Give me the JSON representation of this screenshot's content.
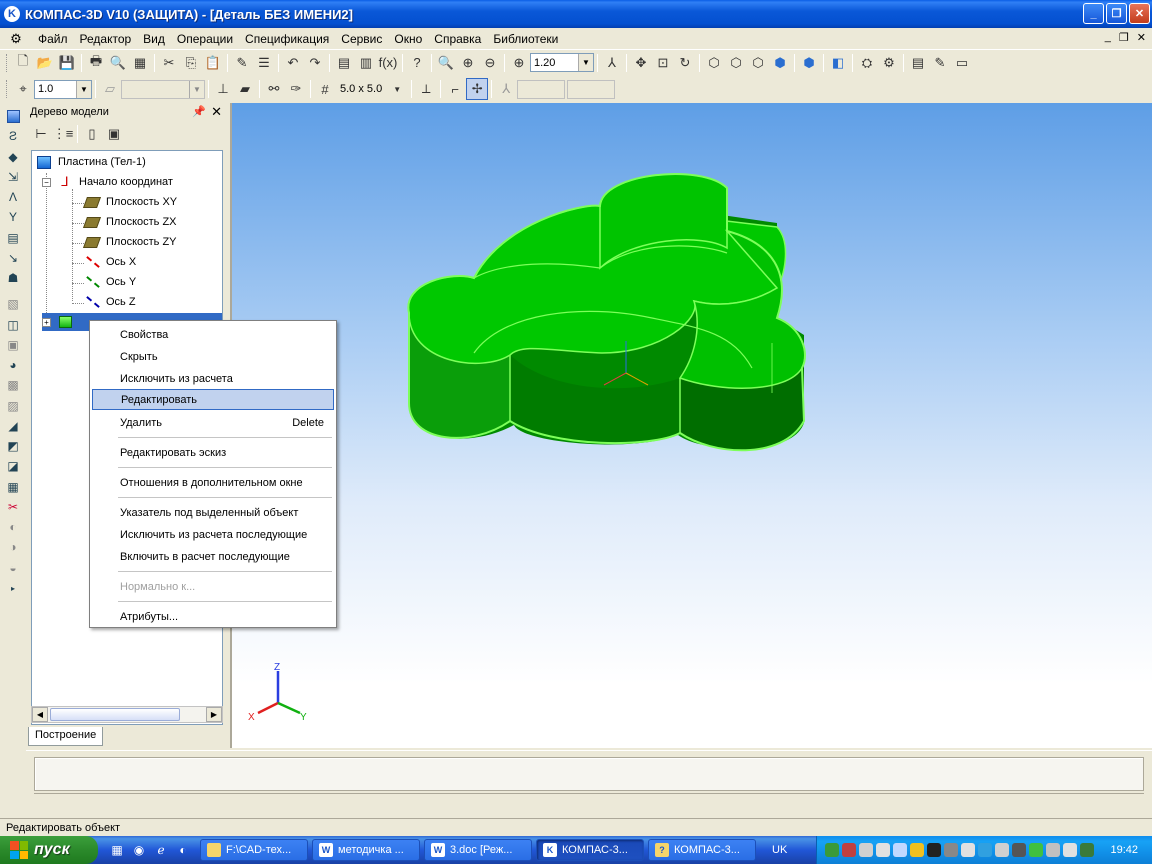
{
  "window": {
    "title": "КОМПАС-3D V10 (ЗАЩИТА) - [Деталь БЕЗ ИМЕНИ2]",
    "app_icon_letter": "K"
  },
  "menu": {
    "items": [
      "Файл",
      "Редактор",
      "Вид",
      "Операции",
      "Спецификация",
      "Сервис",
      "Окно",
      "Справка",
      "Библиотеки"
    ]
  },
  "toolbar": {
    "zoom_value": "1.20",
    "line_step_value": "1.0",
    "grid_value": "5.0 x 5.0",
    "fx_label": "f(x)"
  },
  "tree_panel": {
    "title": "Дерево модели",
    "tab_label": "Построение",
    "items": [
      {
        "label": "Пластина  (Тел-1)"
      },
      {
        "label": "Начало координат"
      },
      {
        "label": "Плоскость XY"
      },
      {
        "label": "Плоскость ZX"
      },
      {
        "label": "Плоскость ZY"
      },
      {
        "label": "Ось X"
      },
      {
        "label": "Ось Y"
      },
      {
        "label": "Ось Z"
      }
    ]
  },
  "context_menu": {
    "items": [
      {
        "label": "Свойства"
      },
      {
        "label": "Скрыть"
      },
      {
        "label": "Исключить из расчета"
      },
      {
        "label": "Редактировать"
      },
      {
        "label": "Удалить",
        "shortcut": "Delete"
      },
      {
        "label": "Редактировать эскиз"
      },
      {
        "label": "Отношения в дополнительном окне"
      },
      {
        "label": "Указатель под выделенный объект"
      },
      {
        "label": "Исключить из расчета последующие"
      },
      {
        "label": "Включить в расчет последующие"
      },
      {
        "label": "Нормально к..."
      },
      {
        "label": "Атрибуты..."
      }
    ]
  },
  "axes": {
    "x": "X",
    "y": "Y",
    "z": "Z"
  },
  "status": {
    "text": "Редактировать объект"
  },
  "taskbar": {
    "start_label": "пуск",
    "buttons": [
      {
        "label": "F:\\CAD-тех..."
      },
      {
        "label": "методичка ..."
      },
      {
        "label": "3.doc [Реж..."
      },
      {
        "label": "КОМПАС-3..."
      },
      {
        "label": "КОМПАС-3..."
      }
    ],
    "language": "UK",
    "clock": "19:42"
  },
  "colors": {
    "model_green": "#00c800",
    "model_edge": "#7dff5a",
    "highlight": "#c1d2ee",
    "titlebar": "#0a58d8"
  }
}
